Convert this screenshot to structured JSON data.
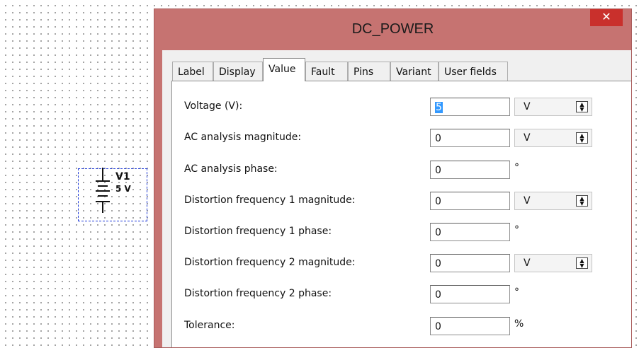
{
  "schematic": {
    "ref": "V1",
    "value": "5 V"
  },
  "dialog": {
    "title": "DC_POWER",
    "close_glyph": "✕",
    "tabs": [
      "Label",
      "Display",
      "Value",
      "Fault",
      "Pins",
      "Variant",
      "User fields"
    ],
    "active_tab": "Value",
    "rows": [
      {
        "label": "Voltage (V):",
        "value": "5",
        "unit": "V",
        "unit_type": "dropdown-spinner"
      },
      {
        "label": "AC analysis magnitude:",
        "value": "0",
        "unit": "V",
        "unit_type": "dropdown-spinner"
      },
      {
        "label": "AC analysis phase:",
        "value": "0",
        "unit": "°",
        "unit_type": "text"
      },
      {
        "label": "Distortion frequency 1 magnitude:",
        "value": "0",
        "unit": "V",
        "unit_type": "dropdown-spinner"
      },
      {
        "label": "Distortion frequency 1 phase:",
        "value": "0",
        "unit": "°",
        "unit_type": "text"
      },
      {
        "label": "Distortion frequency 2 magnitude:",
        "value": "0",
        "unit": "V",
        "unit_type": "dropdown-spinner"
      },
      {
        "label": "Distortion frequency 2 phase:",
        "value": "0",
        "unit": "°",
        "unit_type": "text"
      },
      {
        "label": "Tolerance:",
        "value": "0",
        "unit": "%",
        "unit_type": "text"
      }
    ]
  },
  "colors": {
    "window_frame": "#c67371",
    "close_button": "#c9302c",
    "selection_box": "#1c38d8",
    "text_selection": "#3399ff"
  },
  "icons": {
    "close": "close-icon",
    "spinner": "spinner-updown-icon",
    "battery": "dc-source-symbol-icon"
  }
}
